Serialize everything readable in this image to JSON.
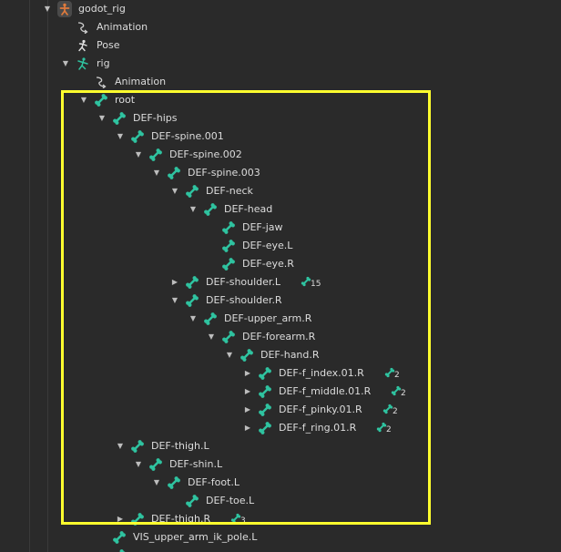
{
  "accent": {
    "bone": "#2fc3a0",
    "rig_icon": "#e07a3c",
    "highlight": "#ffff2e"
  },
  "nodes": [
    {
      "label": "godot_rig",
      "depth": 0,
      "arrow": "expanded",
      "icon": "godot-rig-icon"
    },
    {
      "label": "Animation",
      "depth": 1,
      "arrow": "none",
      "icon": "animation-icon"
    },
    {
      "label": "Pose",
      "depth": 1,
      "arrow": "none",
      "icon": "pose-icon"
    },
    {
      "label": "rig",
      "depth": 1,
      "arrow": "expanded",
      "icon": "armature-icon"
    },
    {
      "label": "Animation",
      "depth": 2,
      "arrow": "none",
      "icon": "animation-icon"
    },
    {
      "label": "root",
      "depth": 2,
      "arrow": "expanded",
      "icon": "bone-icon"
    },
    {
      "label": "DEF-hips",
      "depth": 3,
      "arrow": "expanded",
      "icon": "bone-icon"
    },
    {
      "label": "DEF-spine.001",
      "depth": 4,
      "arrow": "expanded",
      "icon": "bone-icon"
    },
    {
      "label": "DEF-spine.002",
      "depth": 5,
      "arrow": "expanded",
      "icon": "bone-icon"
    },
    {
      "label": "DEF-spine.003",
      "depth": 6,
      "arrow": "expanded",
      "icon": "bone-icon"
    },
    {
      "label": "DEF-neck",
      "depth": 7,
      "arrow": "expanded",
      "icon": "bone-icon"
    },
    {
      "label": "DEF-head",
      "depth": 8,
      "arrow": "expanded",
      "icon": "bone-icon"
    },
    {
      "label": "DEF-jaw",
      "depth": 9,
      "arrow": "none",
      "icon": "bone-icon"
    },
    {
      "label": "DEF-eye.L",
      "depth": 9,
      "arrow": "none",
      "icon": "bone-icon"
    },
    {
      "label": "DEF-eye.R",
      "depth": 9,
      "arrow": "none",
      "icon": "bone-icon"
    },
    {
      "label": "DEF-shoulder.L",
      "depth": 7,
      "arrow": "collapsed",
      "icon": "bone-icon",
      "children_count": "15"
    },
    {
      "label": "DEF-shoulder.R",
      "depth": 7,
      "arrow": "expanded",
      "icon": "bone-icon"
    },
    {
      "label": "DEF-upper_arm.R",
      "depth": 8,
      "arrow": "expanded",
      "icon": "bone-icon"
    },
    {
      "label": "DEF-forearm.R",
      "depth": 9,
      "arrow": "expanded",
      "icon": "bone-icon"
    },
    {
      "label": "DEF-hand.R",
      "depth": 10,
      "arrow": "expanded",
      "icon": "bone-icon"
    },
    {
      "label": "DEF-f_index.01.R",
      "depth": 11,
      "arrow": "collapsed",
      "icon": "bone-icon",
      "children_count": "2"
    },
    {
      "label": "DEF-f_middle.01.R",
      "depth": 11,
      "arrow": "collapsed",
      "icon": "bone-icon",
      "children_count": "2"
    },
    {
      "label": "DEF-f_pinky.01.R",
      "depth": 11,
      "arrow": "collapsed",
      "icon": "bone-icon",
      "children_count": "2"
    },
    {
      "label": "DEF-f_ring.01.R",
      "depth": 11,
      "arrow": "collapsed",
      "icon": "bone-icon",
      "children_count": "2"
    },
    {
      "label": "DEF-thigh.L",
      "depth": 4,
      "arrow": "expanded",
      "icon": "bone-icon"
    },
    {
      "label": "DEF-shin.L",
      "depth": 5,
      "arrow": "expanded",
      "icon": "bone-icon"
    },
    {
      "label": "DEF-foot.L",
      "depth": 6,
      "arrow": "expanded",
      "icon": "bone-icon"
    },
    {
      "label": "DEF-toe.L",
      "depth": 7,
      "arrow": "none",
      "icon": "bone-icon"
    },
    {
      "label": "DEF-thigh.R",
      "depth": 4,
      "arrow": "collapsed",
      "icon": "bone-icon",
      "children_count": "3"
    },
    {
      "label": "VIS_upper_arm_ik_pole.L",
      "depth": 3,
      "arrow": "none",
      "icon": "bone-icon"
    },
    {
      "label": "",
      "depth": 3,
      "arrow": "none",
      "icon": "bone-icon"
    }
  ]
}
